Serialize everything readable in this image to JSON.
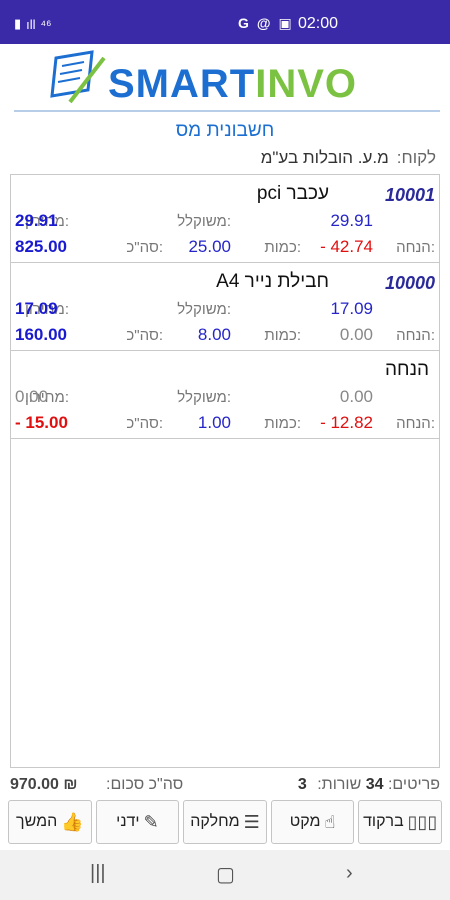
{
  "status_bar": {
    "time": "02:00",
    "icons_right": [
      "G",
      "@",
      "▣"
    ],
    "icons_left": [
      "▮",
      "ıll",
      "⁴⁶"
    ]
  },
  "logo": {
    "left": "SMART",
    "right": "INVO",
    "colors": {
      "smart": "#1c6fd1",
      "invo": "#7cc242"
    }
  },
  "title": "חשבונית מס",
  "customer": {
    "label": "לקוח:",
    "value": "מ.ע. הובלות בע\"מ"
  },
  "items": [
    {
      "code": "10001",
      "name": "עכבר pci",
      "price_label": "מחירון:",
      "price": "29.91",
      "weighted_label": "משוקלל:",
      "weighted": "29.91",
      "discount_label": "הנחה:",
      "discount": "- 42.74",
      "qty_label": "כמות:",
      "qty": "25.00",
      "total_label": "סה\"כ:",
      "total": "825.00"
    },
    {
      "code": "10000",
      "name": "חבילת נייר A4",
      "price_label": "מחירון:",
      "price": "17.09",
      "weighted_label": "משוקלל:",
      "weighted": "17.09",
      "discount_label": "הנחה:",
      "discount": "0.00",
      "qty_label": "כמות:",
      "qty": "8.00",
      "total_label": "סה\"כ:",
      "total": "160.00"
    },
    {
      "code": "",
      "name": "הנחה",
      "price_label": "מחירון:",
      "price": "0.00",
      "weighted_label": "משוקלל:",
      "weighted": "0.00",
      "discount_label": "הנחה:",
      "discount": "- 12.82",
      "qty_label": "כמות:",
      "qty": "1.00",
      "total_label": "סה\"כ:",
      "total": "- 15.00"
    }
  ],
  "summary": {
    "items_label": "פריטים:",
    "items_count": "34",
    "rows_label": "שורות:",
    "rows_count": "3",
    "total_label": "סה\"כ סכום:",
    "total_value": "970.00 ₪"
  },
  "buttons": {
    "barcode": "ברקוד",
    "sku": "מקט",
    "category": "מחלקה",
    "manual": "ידני",
    "continue": "המשך"
  }
}
